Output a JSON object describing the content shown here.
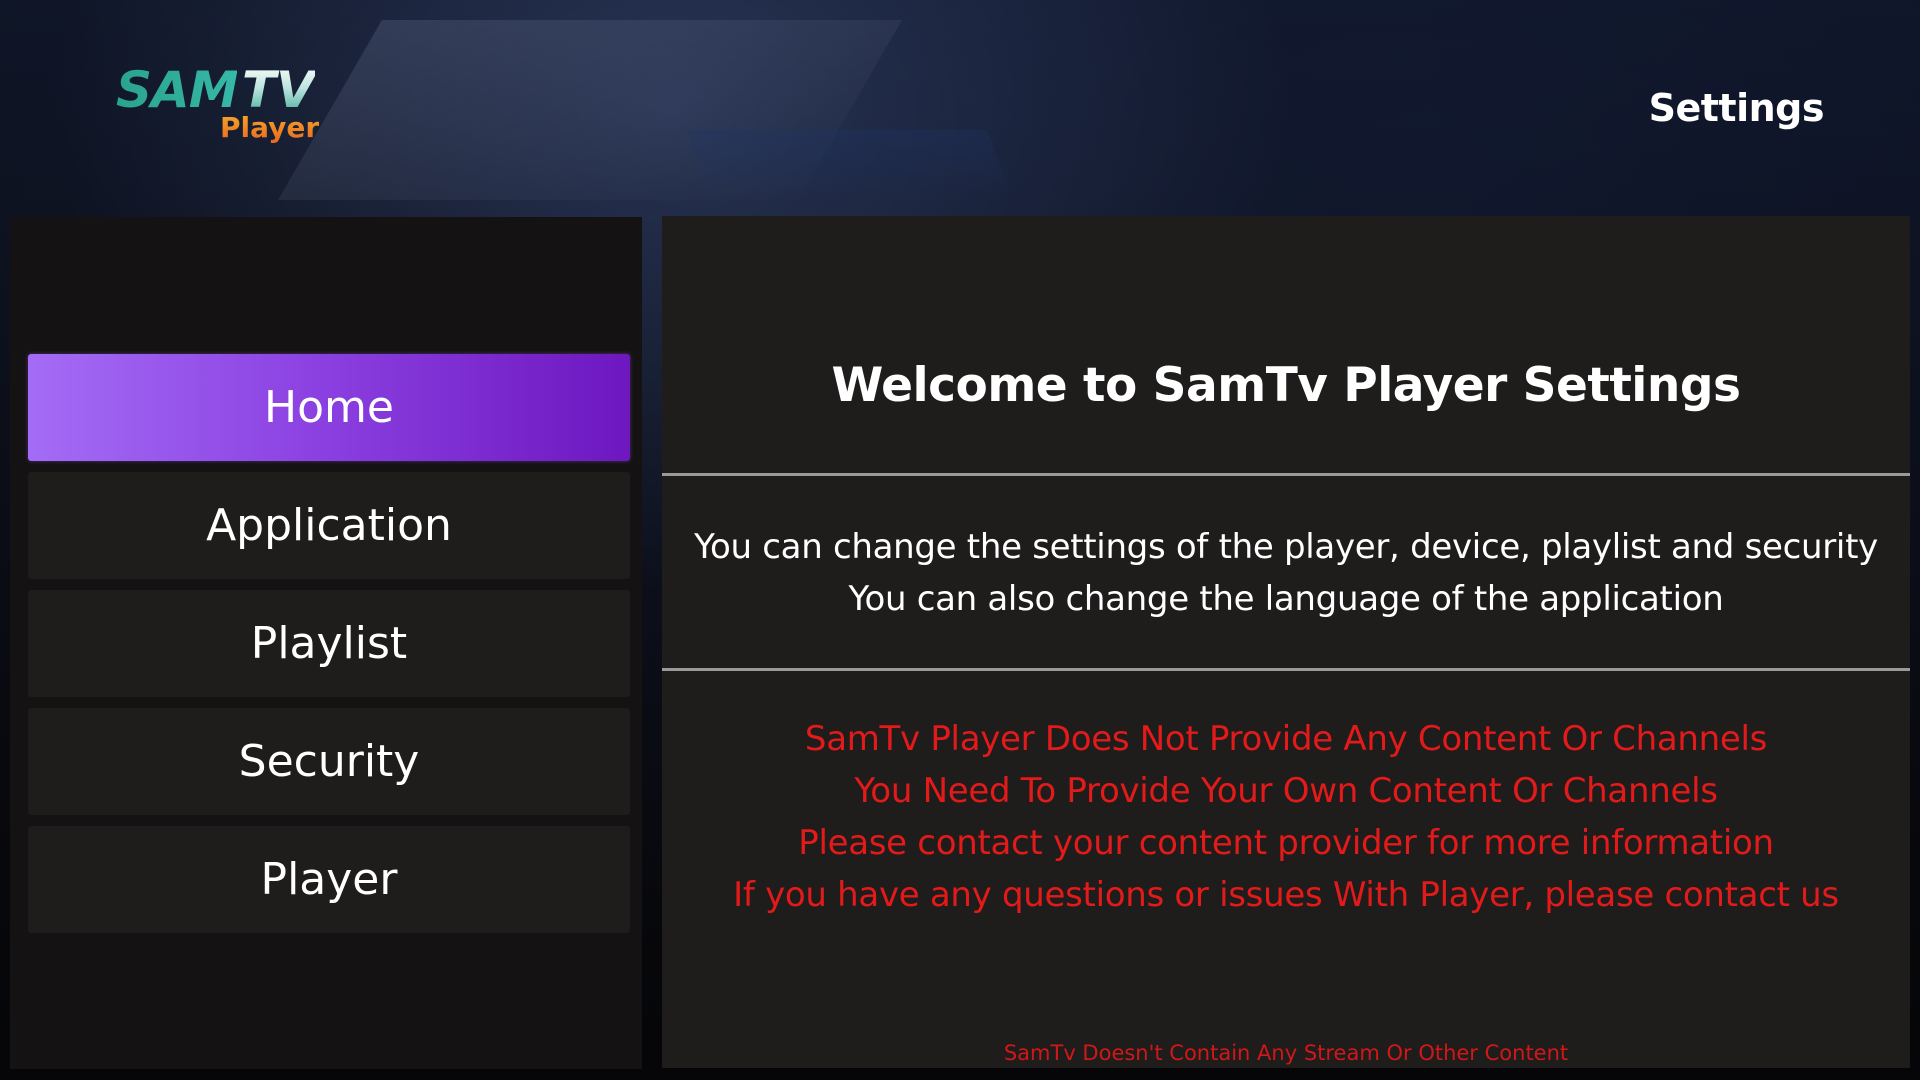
{
  "logo": {
    "brand_part1": "SAM",
    "brand_part2": "TV",
    "subtitle": "Player"
  },
  "header": {
    "title": "Settings"
  },
  "sidebar": {
    "items": [
      {
        "label": "Home",
        "active": true
      },
      {
        "label": "Application",
        "active": false
      },
      {
        "label": "Playlist",
        "active": false
      },
      {
        "label": "Security",
        "active": false
      },
      {
        "label": "Player",
        "active": false
      }
    ]
  },
  "main": {
    "welcome_title": "Welcome to SamTv Player Settings",
    "info_lines": [
      "You can change the settings of the player, device, playlist and security",
      "You can also change the language of the application"
    ],
    "notice_lines": [
      "SamTv Player Does Not Provide Any Content Or Channels",
      "You Need To Provide Your Own Content Or Channels",
      "Please contact your content provider for more information",
      "If you have any questions or issues With Player, please contact us"
    ],
    "footer": "SamTv Doesn't Contain Any Stream Or Other Content"
  },
  "colors": {
    "accent_gradient_start": "#a46cf6",
    "accent_gradient_end": "#6d17c0",
    "panel_bg": "#1f1c1c",
    "sidebar_bg": "#141212",
    "notice_red": "#e21a1a",
    "logo_teal": "#2fae9c",
    "logo_orange": "#f08a1c"
  }
}
